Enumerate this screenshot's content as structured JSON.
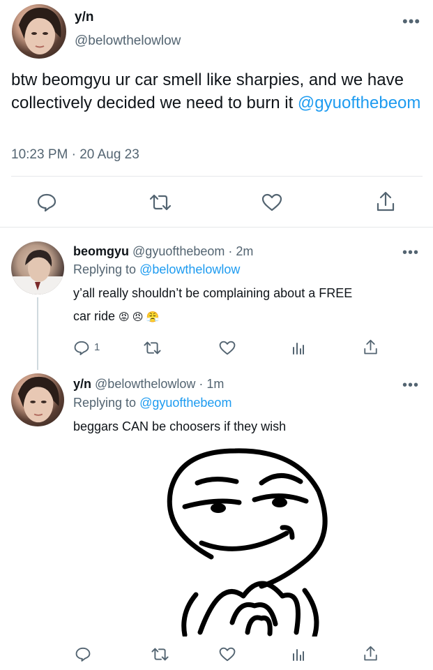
{
  "main_tweet": {
    "display_name": "y/n",
    "handle": "@belowthelowlow",
    "text": "btw beomgyu ur car smell like sharpies, and we have collectively decided we need to burn it",
    "mention": "@gyuofthebeom",
    "timestamp": "10:23 PM · 20 Aug 23",
    "more_label": "•••"
  },
  "reply1": {
    "display_name": "beomgyu",
    "handle_time": "@gyuofthebeom · 2m",
    "replying_prefix": "Replying to",
    "replying_to": "@belowthelowlow",
    "text_line1": "y’all really shouldn’t be complaining about a FREE",
    "text_line2": "car ride",
    "emojis": "😡 😠 😤",
    "reply_count": "1",
    "more_label": "•••"
  },
  "reply2": {
    "display_name": "y/n",
    "handle_time": "@belowthelowlow · 1m",
    "replying_prefix": "Replying to",
    "replying_to": "@gyuofthebeom",
    "text": "beggars CAN be choosers if they wish",
    "image_alt": "smug meme face",
    "more_label": "•••"
  },
  "icons": [
    "reply-icon",
    "retweet-icon",
    "like-icon",
    "analytics-icon",
    "share-icon",
    "more-icon"
  ],
  "colors": {
    "link": "#1d9bf0",
    "muted": "#536471",
    "text": "#0f1419",
    "divider": "#e6e8ea"
  }
}
